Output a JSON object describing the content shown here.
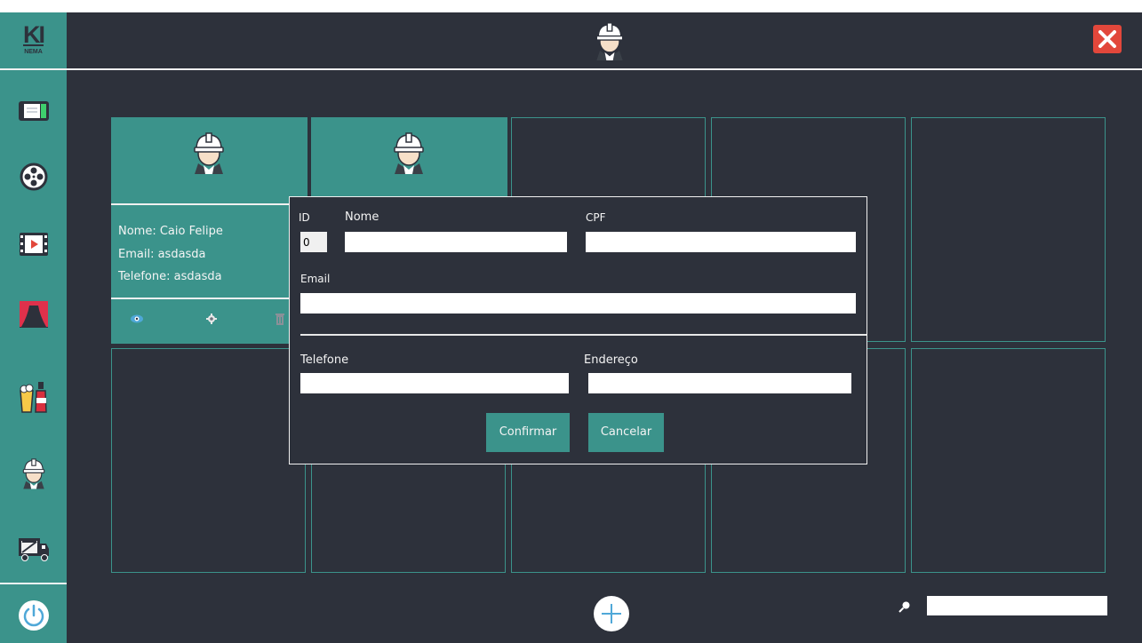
{
  "app": {
    "logo_text": "KI",
    "logo_subtext": "NEMA",
    "header_icon": "worker-icon",
    "close_icon": "close-icon"
  },
  "colors": {
    "teal": "#3b938b",
    "background": "#2d313b",
    "close_red": "#e2473b",
    "line": "#f2f2f2"
  },
  "sidebar": {
    "items": [
      {
        "name": "ticket-icon"
      },
      {
        "name": "film-reel-icon"
      },
      {
        "name": "video-player-icon"
      },
      {
        "name": "theater-curtain-icon"
      },
      {
        "name": "snacks-icon"
      },
      {
        "name": "worker-icon"
      },
      {
        "name": "delivery-truck-icon"
      }
    ],
    "power_icon": "power-icon"
  },
  "cards": [
    {
      "icon": "worker-icon",
      "nome": "Nome: Caio Felipe",
      "email": "Email: asdasda",
      "telefone": "Telefone: asdasda",
      "actions": [
        "eye-icon",
        "gear-icon",
        "trash-icon"
      ]
    },
    {
      "icon": "worker-icon"
    }
  ],
  "modal": {
    "id_label": "ID",
    "id_value": "0",
    "nome_label": "Nome",
    "nome_value": "",
    "cpf_label": "CPF",
    "cpf_value": "",
    "email_label": "Email",
    "email_value": "",
    "telefone_label": "Telefone",
    "telefone_value": "",
    "endereco_label": "Endereço",
    "endereco_value": "",
    "confirm_label": "Confirmar",
    "cancel_label": "Cancelar"
  },
  "footer": {
    "add_icon": "plus-icon",
    "search_icon": "search-icon",
    "search_value": ""
  }
}
